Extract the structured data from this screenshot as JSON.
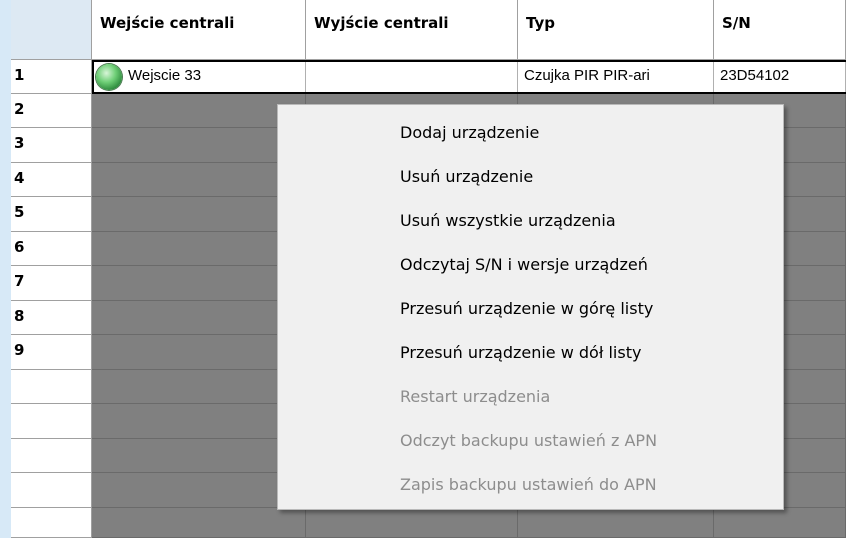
{
  "columns": [
    "Wejście centrali",
    "Wyjście centrali",
    "Typ",
    "S/N"
  ],
  "rows": [
    {
      "num": "1",
      "input": "Wejscie 33",
      "output": "",
      "type": "Czujka PIR PIR-ari",
      "sn": "23D54102",
      "status_color": "#4cbb5a"
    },
    {
      "num": "2"
    },
    {
      "num": "3"
    },
    {
      "num": "4"
    },
    {
      "num": "5"
    },
    {
      "num": "6"
    },
    {
      "num": "7"
    },
    {
      "num": "8"
    },
    {
      "num": "9"
    }
  ],
  "context_menu": {
    "items": [
      {
        "label": "Dodaj urządzenie",
        "enabled": true
      },
      {
        "label": "Usuń urządzenie",
        "enabled": true
      },
      {
        "label": "Usuń wszystkie urządzenia",
        "enabled": true
      },
      {
        "label": "Odczytaj S/N i wersje urządzeń",
        "enabled": true
      },
      {
        "label": "Przesuń urządzenie w górę listy",
        "enabled": true
      },
      {
        "label": "Przesuń urządzenie w dół listy",
        "enabled": true
      },
      {
        "label": "Restart urządzenia",
        "enabled": false
      },
      {
        "label": "Odczyt backupu ustawień z APN",
        "enabled": false
      },
      {
        "label": "Zapis backupu ustawień do APN",
        "enabled": false
      }
    ]
  }
}
